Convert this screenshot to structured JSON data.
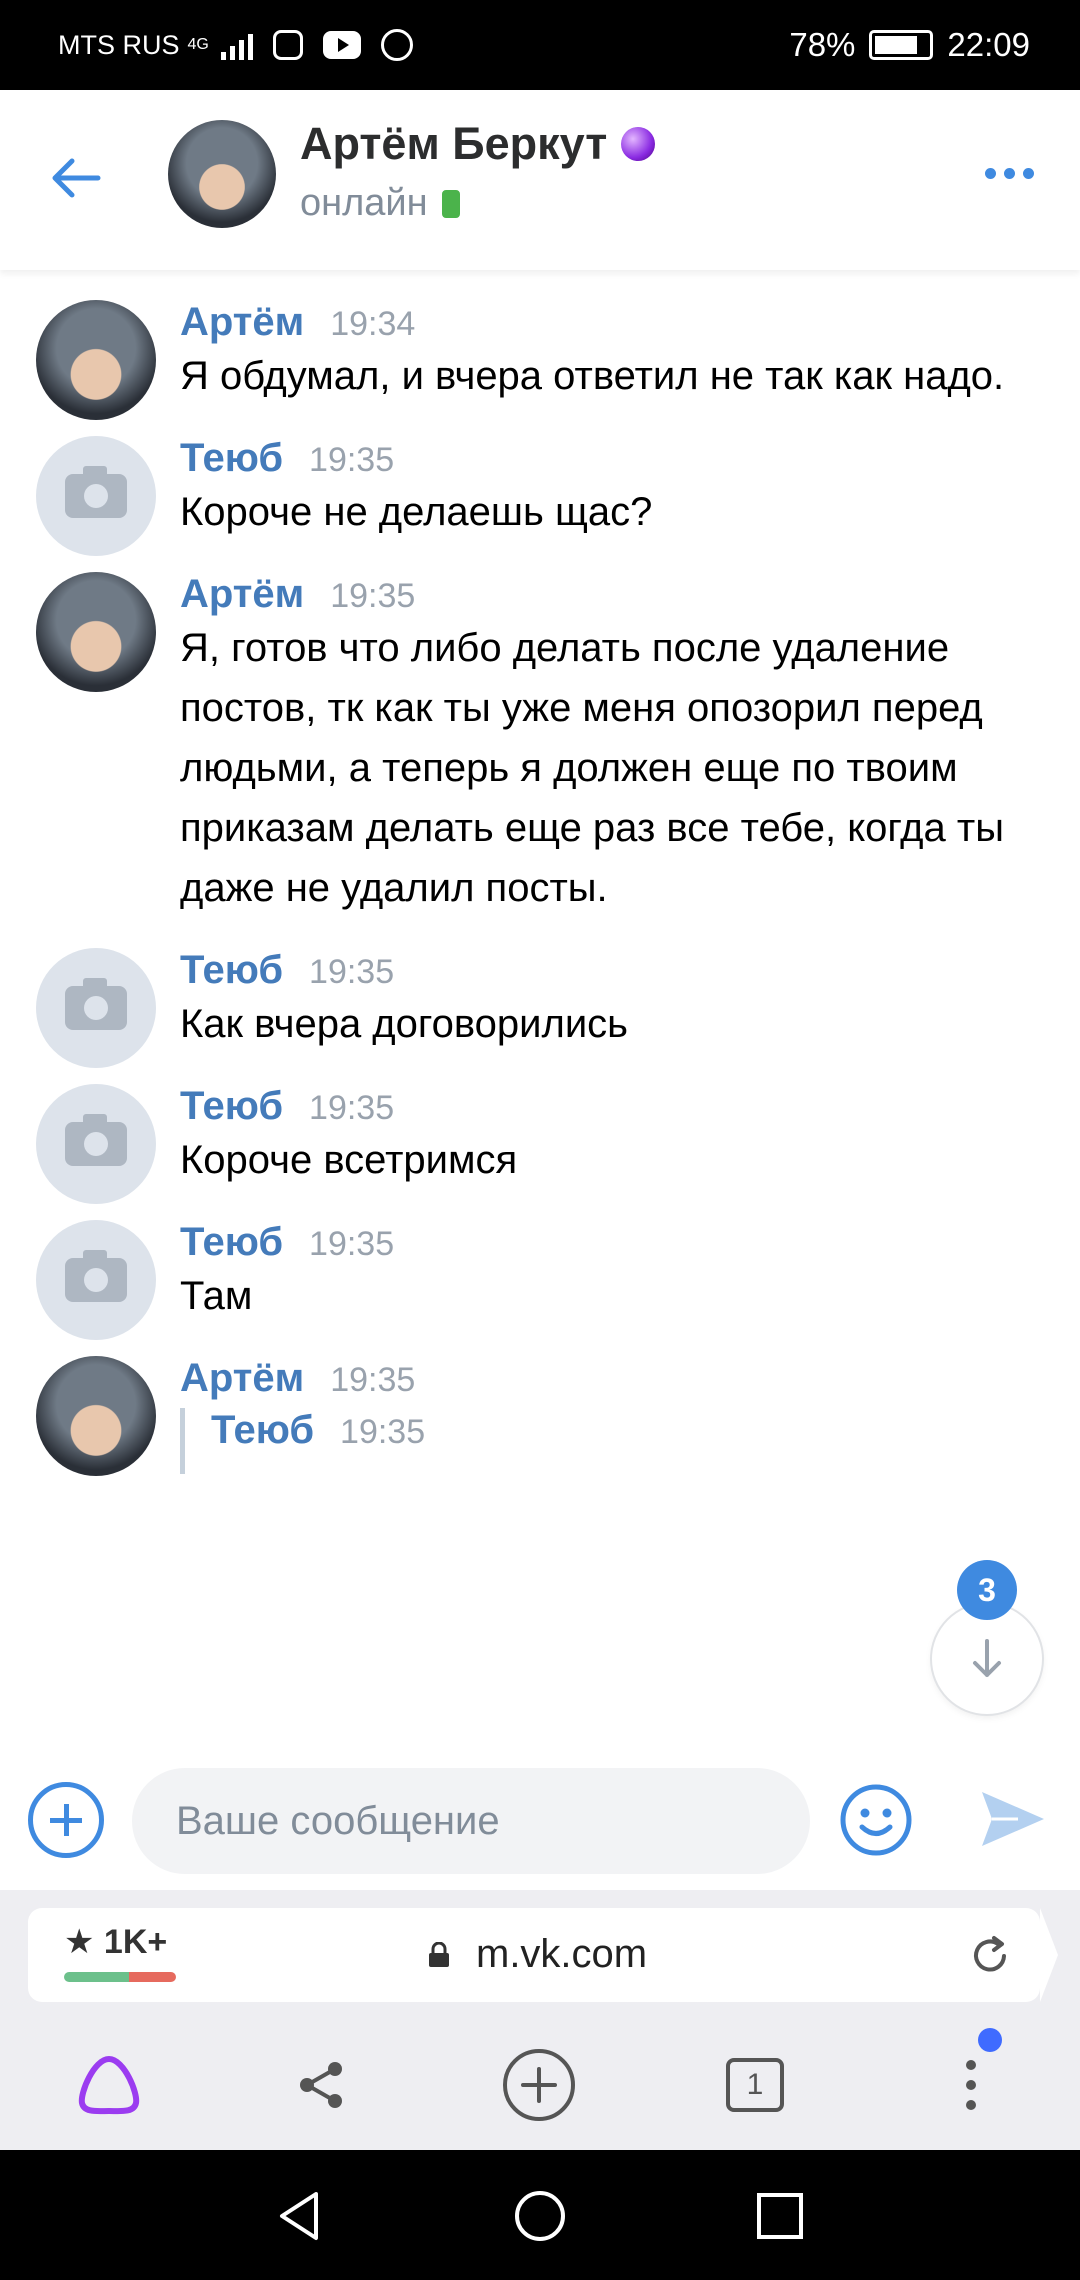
{
  "status_bar": {
    "carrier": "MTS RUS",
    "network": "4G",
    "battery": "78%",
    "time": "22:09"
  },
  "header": {
    "name": "Артём Беркут",
    "status": "онлайн"
  },
  "messages": [
    {
      "author": "Артём",
      "time": "19:34",
      "avatar": "photo",
      "text": "Я обдумал, и вчера ответил не так как надо."
    },
    {
      "author": "Теюб",
      "time": "19:35",
      "avatar": "camera",
      "text": "Короче не делаешь щас?"
    },
    {
      "author": "Артём",
      "time": "19:35",
      "avatar": "photo",
      "text": "Я, готов что либо делать после удаление постов, тк как ты уже меня опозорил перед людьми, а теперь я должен еще по твоим приказам делать еще раз все тебе, когда ты даже не удалил посты."
    },
    {
      "author": "Теюб",
      "time": "19:35",
      "avatar": "camera",
      "text": "Как вчера договорились"
    },
    {
      "author": "Теюб",
      "time": "19:35",
      "avatar": "camera",
      "text": "Короче всетримся"
    },
    {
      "author": "Теюб",
      "time": "19:35",
      "avatar": "camera",
      "text": "Там"
    },
    {
      "author": "Артём",
      "time": "19:35",
      "avatar": "photo",
      "quote": {
        "author": "Теюб",
        "time": "19:35"
      }
    }
  ],
  "unread_count": "3",
  "composer": {
    "placeholder": "Ваше сообщение"
  },
  "browser": {
    "rating": "★ 1K+",
    "domain": "m.vk.com",
    "tabs_count": "1"
  },
  "colors": {
    "accent": "#3f8ae0",
    "author": "#447bba",
    "online": "#4bb34b"
  }
}
